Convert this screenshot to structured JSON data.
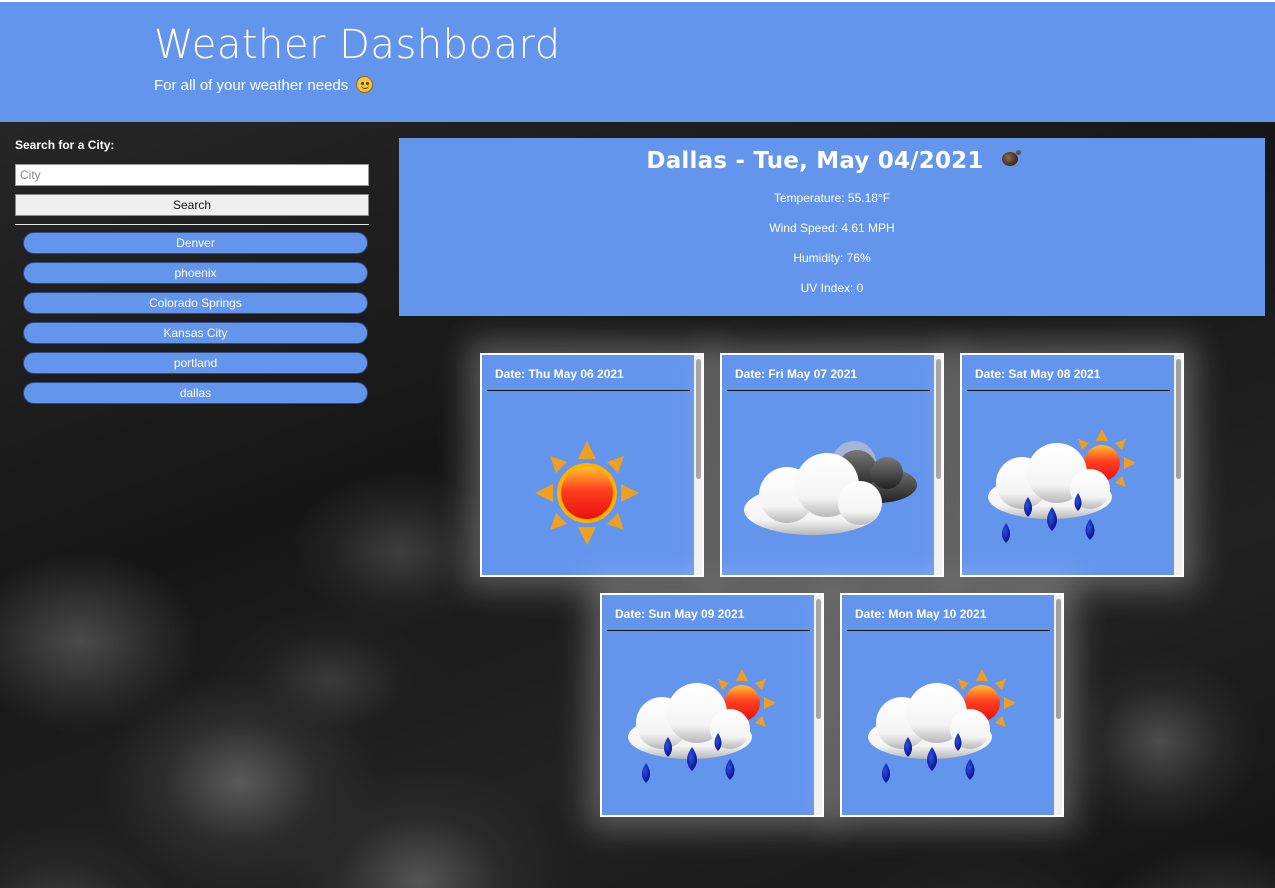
{
  "header": {
    "title": "Weather Dashboard",
    "subtitle": "For all of your weather needs"
  },
  "sidebar": {
    "search_label": "Search for a City:",
    "input_placeholder": "City",
    "input_value": "",
    "search_button": "Search",
    "history": [
      "Denver",
      "phoenix",
      "Colorado Springs",
      "Kansas City",
      "portland",
      "dallas"
    ]
  },
  "current": {
    "heading": "Dallas - Tue, May 04/2021",
    "icon": "night-cloud-icon",
    "temperature": "Temperature: 55.18°F",
    "wind": "Wind Speed: 4.61 MPH",
    "humidity": "Humidity: 76%",
    "uv": "UV Index: 0"
  },
  "forecast": [
    {
      "date": "Date: Thu May 06 2021",
      "icon": "sun-icon"
    },
    {
      "date": "Date: Fri May 07 2021",
      "icon": "cloudy-icon"
    },
    {
      "date": "Date: Sat May 08 2021",
      "icon": "rain-sun-icon"
    },
    {
      "date": "Date: Sun May 09 2021",
      "icon": "rain-sun-icon"
    },
    {
      "date": "Date: Mon May 10 2021",
      "icon": "rain-sun-icon"
    }
  ],
  "colors": {
    "accent": "#6495ed",
    "background": "#1b1b1b"
  }
}
